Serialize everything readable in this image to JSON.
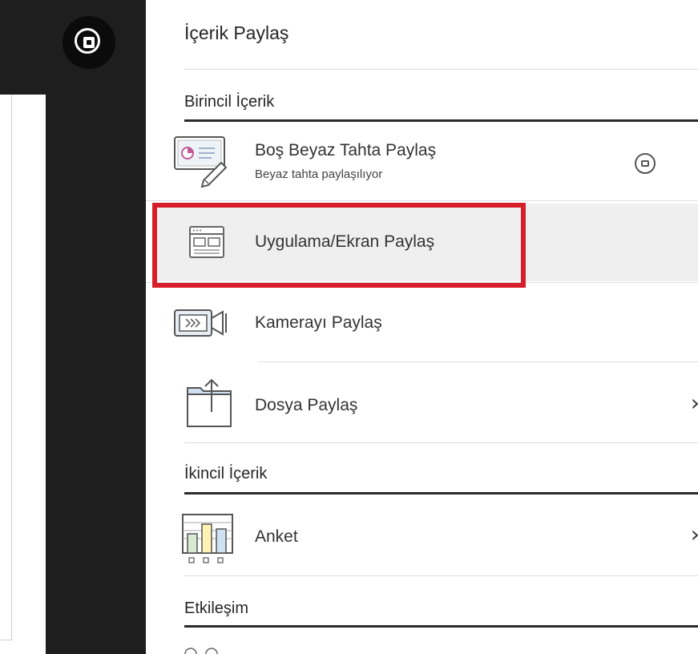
{
  "panel": {
    "title": "İçerik Paylaş"
  },
  "sections": {
    "primary": {
      "heading": "Birincil İçerik",
      "items": [
        {
          "label": "Boş Beyaz Tahta Paylaş",
          "sublabel": "Beyaz tahta paylaşılıyor",
          "icon": "whiteboard-icon",
          "action_icon": "stop-sharing-icon"
        },
        {
          "label": "Uygulama/Ekran Paylaş",
          "icon": "application-window-icon",
          "highlighted": true
        },
        {
          "label": "Kamerayı Paylaş",
          "icon": "camera-icon"
        },
        {
          "label": "Dosya Paylaş",
          "icon": "folder-upload-icon",
          "has_submenu": true
        }
      ]
    },
    "secondary": {
      "heading": "İkincil İçerik",
      "items": [
        {
          "label": "Anket",
          "icon": "poll-chart-icon",
          "has_submenu": true
        }
      ]
    },
    "interaction": {
      "heading": "Etkileşim"
    }
  },
  "colors": {
    "sidebar": "#1e1e1e",
    "highlight_border": "#d71f2b",
    "row_highlight": "#efefef"
  }
}
